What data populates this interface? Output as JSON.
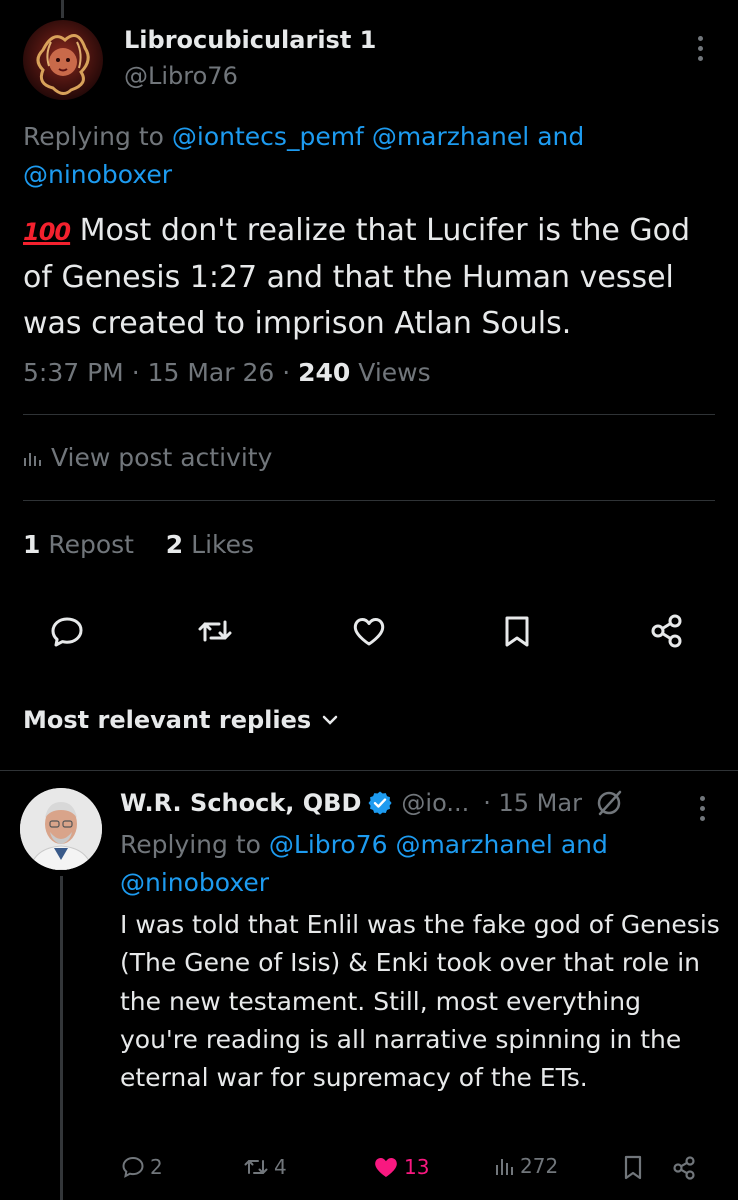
{
  "post": {
    "author_name": "Librocubicularist 1",
    "author_handle": "@Libro76",
    "replying_to_prefix": "Replying to",
    "replying_to_1": "@iontecs_pemf",
    "replying_to_2": "@marzhanel",
    "replying_to_and": "and",
    "replying_to_3": "@ninoboxer",
    "emoji": "100",
    "text": " Most don't realize that Lucifer is the God of Genesis 1:27 and that the Human vessel was created to imprison Atlan Souls.",
    "time": "5:37 PM",
    "sep": "·",
    "date": "15 Mar 26",
    "views_count": "240",
    "views_label": "Views",
    "activity_label": "View post activity",
    "repost_count": "1",
    "repost_label": "Repost",
    "likes_count": "2",
    "likes_label": "Likes"
  },
  "actions": {
    "reply_icon": "reply-icon",
    "repost_icon": "repost-icon",
    "like_icon": "heart-icon",
    "bookmark_icon": "bookmark-icon",
    "share_icon": "share-icon"
  },
  "replies_sort": {
    "label": "Most relevant replies"
  },
  "reply": {
    "author_name": "W.R. Schock, QBD",
    "author_handle": "@io...",
    "date": "15 Mar",
    "replying_to_prefix": "Replying to",
    "replying_to_1": "@Libro76",
    "replying_to_2": "@marzhanel",
    "replying_to_and": "and",
    "replying_to_3": "@ninoboxer",
    "text": "I was told that Enlil was the fake god of Genesis (The Gene of Isis) & Enki took over that role in the new testament. Still, most everything you're reading is all narrative spinning in the eternal war for supremacy of the ETs.",
    "reply_count": "2",
    "repost_count": "4",
    "like_count": "13",
    "view_count": "272"
  },
  "colors": {
    "background": "#000000",
    "text": "#e7e9ea",
    "muted": "#71767b",
    "link": "#1d9bf0",
    "like": "#f91880",
    "divider": "#2f3336"
  }
}
